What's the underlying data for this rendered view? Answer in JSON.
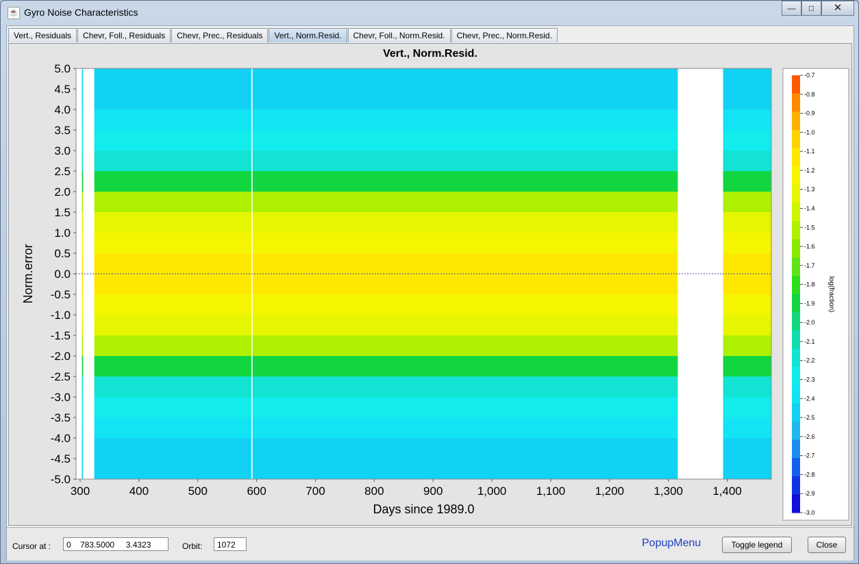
{
  "window": {
    "title": "Gyro Noise Characteristics",
    "minimize_glyph": "—",
    "maximize_glyph": "□",
    "close_glyph": "✕"
  },
  "tabs": [
    {
      "label": "Vert., Residuals"
    },
    {
      "label": "Chevr, Foll., Residuals"
    },
    {
      "label": "Chevr, Prec., Residuals"
    },
    {
      "label": "Vert., Norm.Resid."
    },
    {
      "label": "Chevr, Foll., Norm.Resid."
    },
    {
      "label": "Chevr, Prec., Norm.Resid."
    }
  ],
  "active_tab": 3,
  "chart_data": {
    "type": "heatmap",
    "title": "Vert., Norm.Resid.",
    "xlabel": "Days since 1989.0",
    "ylabel": "Norm.error",
    "xlim": [
      293,
      1475
    ],
    "ylim": [
      -5.0,
      5.0
    ],
    "x_ticks": [
      "300",
      "400",
      "500",
      "600",
      "700",
      "800",
      "900",
      "1,000",
      "1,100",
      "1,200",
      "1,300",
      "1,400"
    ],
    "y_ticks": [
      "5.0",
      "4.5",
      "4.0",
      "3.5",
      "3.0",
      "2.5",
      "2.0",
      "1.5",
      "1.0",
      "0.5",
      "0.0",
      "-0.5",
      "-1.0",
      "-1.5",
      "-2.0",
      "-2.5",
      "-3.0",
      "-3.5",
      "-4.0",
      "-4.5",
      "-5.0"
    ],
    "data_segments": [
      {
        "x_start": 303,
        "x_end": 305
      },
      {
        "x_start": 324,
        "x_end": 591
      },
      {
        "x_start": 593,
        "x_end": 1316
      },
      {
        "x_start": 1393,
        "x_end": 1475
      }
    ],
    "bin_profile_log_fraction": [
      {
        "y": 4.75,
        "value": -2.5
      },
      {
        "y": 4.25,
        "value": -2.45
      },
      {
        "y": 3.75,
        "value": -2.35
      },
      {
        "y": 3.25,
        "value": -2.3
      },
      {
        "y": 2.75,
        "value": -2.15
      },
      {
        "y": 2.25,
        "value": -1.85
      },
      {
        "y": 1.75,
        "value": -1.45
      },
      {
        "y": 1.25,
        "value": -1.25
      },
      {
        "y": 0.75,
        "value": -1.15
      },
      {
        "y": 0.25,
        "value": -1.05
      },
      {
        "y": -0.25,
        "value": -1.05
      },
      {
        "y": -0.75,
        "value": -1.15
      },
      {
        "y": -1.25,
        "value": -1.25
      },
      {
        "y": -1.75,
        "value": -1.45
      },
      {
        "y": -2.25,
        "value": -1.85
      },
      {
        "y": -2.75,
        "value": -2.15
      },
      {
        "y": -3.25,
        "value": -2.3
      },
      {
        "y": -3.75,
        "value": -2.35
      },
      {
        "y": -4.25,
        "value": -2.45
      },
      {
        "y": -4.75,
        "value": -2.5
      }
    ],
    "zero_line": true,
    "grid": false,
    "colorbar": {
      "label": "log(fraction)",
      "placement": "right",
      "range": [
        -3.0,
        -0.7
      ],
      "ticks": [
        "-0.7",
        "-0.8",
        "-0.9",
        "-1.0",
        "-1.1",
        "-1.2",
        "-1.3",
        "-1.4",
        "-1.5",
        "-1.6",
        "-1.7",
        "-1.8",
        "-1.9",
        "-2.0",
        "-2.1",
        "-2.2",
        "-2.3",
        "-2.4",
        "-2.5",
        "-2.6",
        "-2.7",
        "-2.8",
        "-2.9",
        "-3.0"
      ],
      "colors": [
        "#ff5a00",
        "#ff8a00",
        "#ffb000",
        "#ffd200",
        "#ffe800",
        "#f5f500",
        "#e5f600",
        "#cff500",
        "#aff000",
        "#8aea00",
        "#5fe41a",
        "#2ede1c",
        "#12d640",
        "#12d77c",
        "#12dcae",
        "#12e3d2",
        "#12ecec",
        "#12e4f4",
        "#12d2f4",
        "#20b8f0",
        "#1c8ef0",
        "#1460ec",
        "#1034e4",
        "#1010d8"
      ]
    }
  },
  "status": {
    "cursor_label": "Cursor at :",
    "cursor_value": "0    783.5000     3.4323",
    "orbit_label": "Orbit:",
    "orbit_value": "1072",
    "popup_menu": "PopupMenu",
    "toggle_legend": "Toggle legend",
    "close": "Close"
  }
}
